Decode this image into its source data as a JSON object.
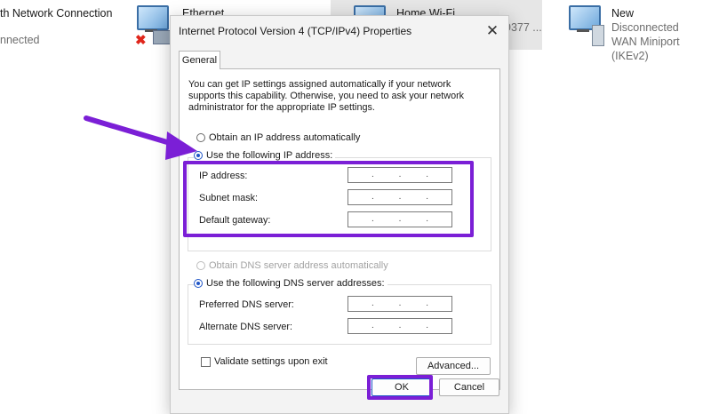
{
  "background": {
    "connections": [
      {
        "name": "th Network Connection",
        "status": "nnected"
      },
      {
        "name": "Ethernet",
        "status": ""
      },
      {
        "name": "Home Wi-Fi",
        "status": "9377 ..."
      },
      {
        "name": "New",
        "status": "Disconnected",
        "device": "WAN Miniport (IKEv2)"
      }
    ]
  },
  "dialog": {
    "title": "Internet Protocol Version 4 (TCP/IPv4) Properties",
    "close_symbol": "✕",
    "tab_general": "General",
    "intro_text": "You can get IP settings assigned automatically if your network supports this capability. Otherwise, you need to ask your network administrator for the appropriate IP settings.",
    "ip_auto_label": "Obtain an IP address automatically",
    "ip_manual_label": "Use the following IP address:",
    "ip_address_label": "IP address:",
    "subnet_mask_label": "Subnet mask:",
    "default_gateway_label": "Default gateway:",
    "dns_auto_label": "Obtain DNS server address automatically",
    "dns_manual_label": "Use the following DNS server addresses:",
    "preferred_dns_label": "Preferred DNS server:",
    "alternate_dns_label": "Alternate DNS server:",
    "ip_dot": ".",
    "validate_label": "Validate settings upon exit",
    "advanced_label": "Advanced...",
    "ok_label": "OK",
    "cancel_label": "Cancel"
  },
  "colors": {
    "annotation": "#7b1fd6",
    "radio_selected": "#1f55c7",
    "error_x": "#e0261b"
  }
}
